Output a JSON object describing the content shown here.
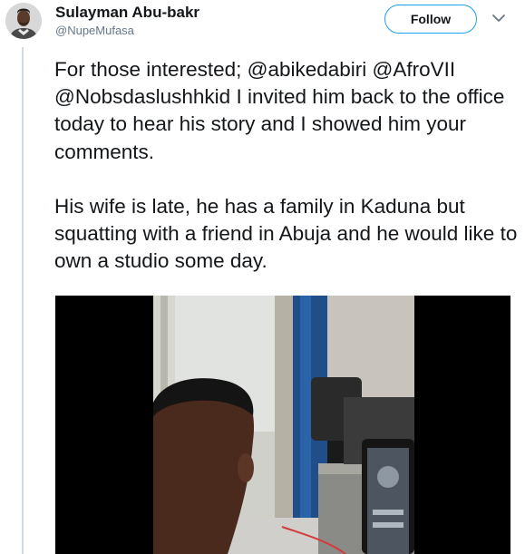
{
  "tweet": {
    "author": {
      "name": "Sulayman Abu-bakr",
      "handle": "@NupeMufasa"
    },
    "follow_label": "Follow",
    "paragraphs": [
      "For those interested; @abikedabiri @AfroVII @Nobsdaslushhkid I invited him back to the office today to hear his story and I showed him your comments.",
      "His wife is late, he has a family in Kaduna but squatting with a friend in Abuja and he would like to own a studio some day."
    ]
  },
  "colors": {
    "accent": "#1da1f2",
    "text": "#14171a",
    "secondary_text": "#657786"
  },
  "icons": {
    "menu": "chevron-down-icon"
  }
}
